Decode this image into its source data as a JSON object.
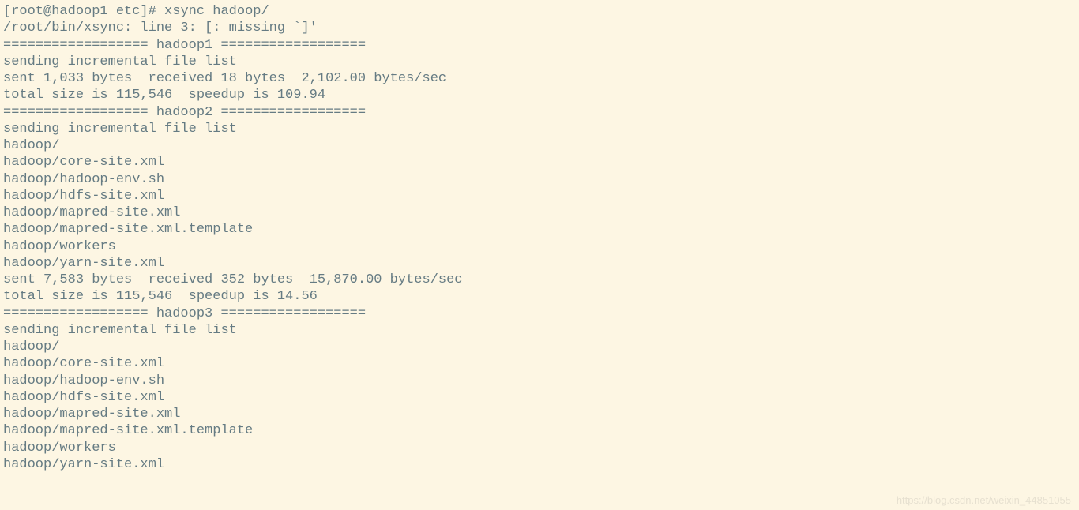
{
  "terminal": {
    "prompt": "[root@hadoop1 etc]# ",
    "command": "xsync hadoop/",
    "output_lines": [
      "/root/bin/xsync: line 3: [: missing `]'",
      "================== hadoop1 ==================",
      "sending incremental file list",
      "",
      "sent 1,033 bytes  received 18 bytes  2,102.00 bytes/sec",
      "total size is 115,546  speedup is 109.94",
      "================== hadoop2 ==================",
      "sending incremental file list",
      "hadoop/",
      "hadoop/core-site.xml",
      "hadoop/hadoop-env.sh",
      "hadoop/hdfs-site.xml",
      "hadoop/mapred-site.xml",
      "hadoop/mapred-site.xml.template",
      "hadoop/workers",
      "hadoop/yarn-site.xml",
      "",
      "sent 7,583 bytes  received 352 bytes  15,870.00 bytes/sec",
      "total size is 115,546  speedup is 14.56",
      "================== hadoop3 ==================",
      "sending incremental file list",
      "hadoop/",
      "hadoop/core-site.xml",
      "hadoop/hadoop-env.sh",
      "hadoop/hdfs-site.xml",
      "hadoop/mapred-site.xml",
      "hadoop/mapred-site.xml.template",
      "hadoop/workers",
      "hadoop/yarn-site.xml"
    ]
  },
  "watermark": "https://blog.csdn.net/weixin_44851055"
}
